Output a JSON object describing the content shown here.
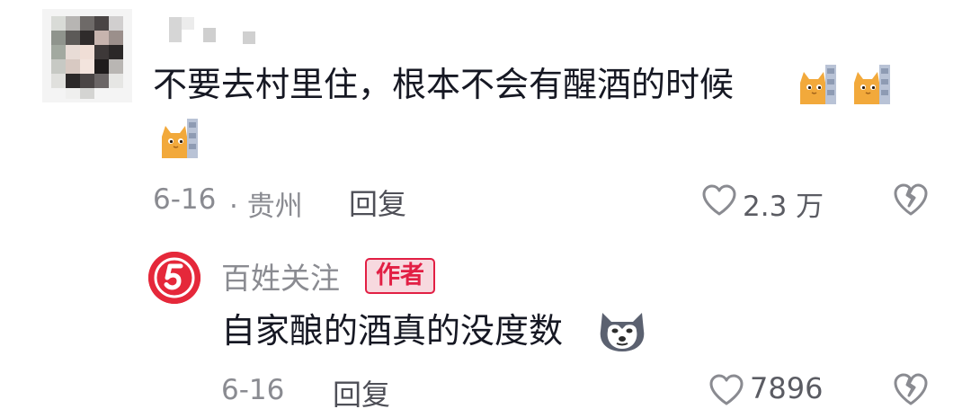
{
  "comment": {
    "username": "",
    "text": "不要去村里住，根本不会有醒酒的时候",
    "emojis": [
      "cat-peek-emoji",
      "cat-peek-emoji",
      "cat-peek-emoji"
    ],
    "date": "6-16",
    "location": "· 贵州",
    "reply_label": "回复",
    "like_count": "2.3 万"
  },
  "author_reply": {
    "username": "百姓关注",
    "badge": "作者",
    "text": "自家酿的酒真的没度数",
    "emoji": "husky-emoji",
    "date": "6-16",
    "reply_label": "回复",
    "like_count": "7896"
  },
  "colors": {
    "text": "#161823",
    "meta": "#8a8b91",
    "author_badge": "#e21f44",
    "author_avatar": "#e5283a"
  }
}
